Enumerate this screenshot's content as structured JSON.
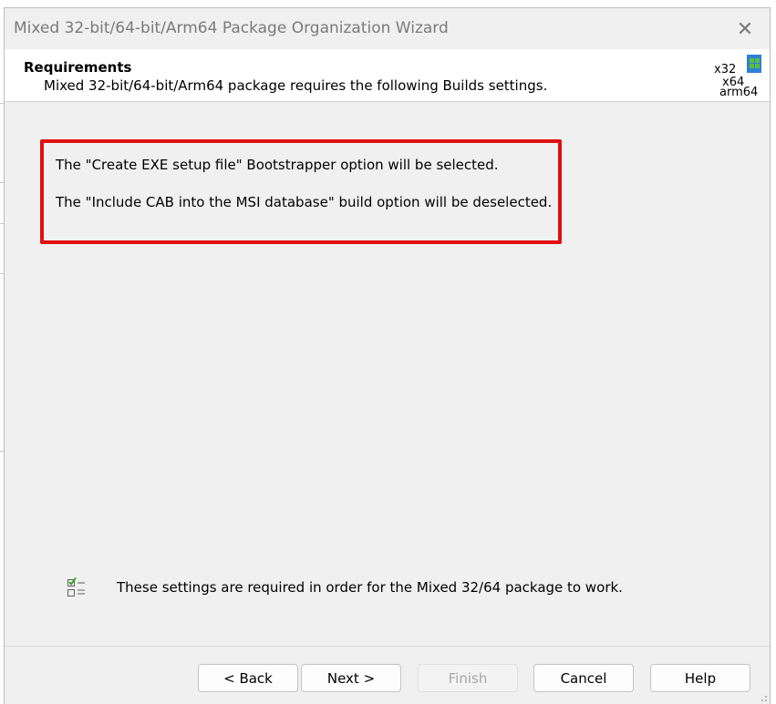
{
  "window": {
    "title": "Mixed 32-bit/64-bit/Arm64 Package Organization Wizard",
    "close_glyph": "✕"
  },
  "header": {
    "title": "Requirements",
    "subtitle": "Mixed 32-bit/64-bit/Arm64 package requires the following Builds settings.",
    "arch_icon": {
      "name": "architecture-icon",
      "labels": [
        "x32",
        "x64",
        "arm64"
      ]
    }
  },
  "requirements": [
    "The \"Create EXE setup file\" Bootstrapper option will be selected.",
    "The \"Include CAB into the MSI database\" build option will be deselected."
  ],
  "note": {
    "icon": "checklist-icon",
    "text": "These settings are required in order for the Mixed 32/64 package to work."
  },
  "buttons": {
    "back": "< Back",
    "next": "Next >",
    "finish": "Finish",
    "cancel": "Cancel",
    "help": "Help"
  },
  "colors": {
    "highlight_border": "#e01010",
    "dialog_bg": "#f0f0f0",
    "header_bg": "#ffffff",
    "icon_blue": "#2f7fd6",
    "icon_green": "#5bbf3d"
  }
}
